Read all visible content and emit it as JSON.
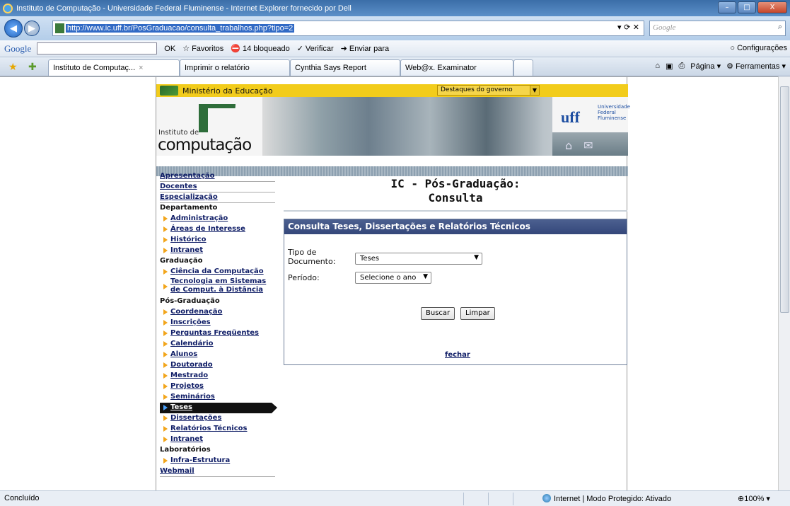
{
  "window": {
    "title": "Instituto de Computação - Universidade Federal Fluminense - Internet Explorer fornecido por Dell",
    "buttons": [
      "–",
      "□",
      "X"
    ]
  },
  "address": {
    "url": "http://www.ic.uff.br/PosGraduacao/consulta_trabalhos.php?tipo=2",
    "search_placeholder": "Google"
  },
  "google_bar": {
    "logo": "Google",
    "ok": "OK",
    "favoritos": "Favoritos",
    "bloqueado": "14 bloqueado",
    "verificar": "Verificar",
    "enviar": "Enviar para",
    "configuracoes": "Configurações"
  },
  "tabs": [
    {
      "label": "Instituto de Computaç...",
      "active": true
    },
    {
      "label": "Imprimir o relatório"
    },
    {
      "label": "Cynthia Says Report"
    },
    {
      "label": "Web@x. Examinator"
    }
  ],
  "tab_tools": {
    "pagina": "Página",
    "ferramentas": "Ferramentas"
  },
  "gov_bar": {
    "ministerio": "Ministério da Educação",
    "destaques": "Destaques do governo"
  },
  "banner": {
    "instituto": "Instituto de",
    "computacao": "computação",
    "uff_mark": "uff",
    "uff_name": [
      "Universidade",
      "Federal",
      "Fluminense"
    ]
  },
  "sidebar": {
    "items": [
      {
        "type": "top",
        "label": "Apresentação"
      },
      {
        "type": "top",
        "label": "Docentes"
      },
      {
        "type": "top",
        "label": "Especialização"
      },
      {
        "type": "cat",
        "label": "Departamento"
      },
      {
        "type": "sub",
        "label": "Administração"
      },
      {
        "type": "sub",
        "label": "Áreas de Interesse"
      },
      {
        "type": "sub",
        "label": "Histórico"
      },
      {
        "type": "sub",
        "label": "Intranet"
      },
      {
        "type": "cat",
        "label": "Graduação"
      },
      {
        "type": "sub",
        "label": "Ciência da Computação"
      },
      {
        "type": "sub2",
        "label": "Tecnologia em Sistemas",
        "label2": "de Comput. à Distância"
      },
      {
        "type": "cat",
        "label": "Pós-Graduação"
      },
      {
        "type": "sub",
        "label": "Coordenação"
      },
      {
        "type": "sub",
        "label": "Inscrições"
      },
      {
        "type": "sub",
        "label": "Perguntas Freqüentes"
      },
      {
        "type": "sub",
        "label": "Calendário"
      },
      {
        "type": "sub",
        "label": "Alunos"
      },
      {
        "type": "sub",
        "label": "Doutorado"
      },
      {
        "type": "sub",
        "label": "Mestrado"
      },
      {
        "type": "sub",
        "label": "Projetos"
      },
      {
        "type": "sub",
        "label": "Seminários"
      },
      {
        "type": "sub",
        "label": "Teses",
        "active": true
      },
      {
        "type": "sub",
        "label": "Dissertações"
      },
      {
        "type": "sub",
        "label": "Relatórios Técnicos"
      },
      {
        "type": "sub",
        "label": "Intranet"
      },
      {
        "type": "cat",
        "label": "Laboratórios"
      },
      {
        "type": "sub",
        "label": "Infra-Estrutura"
      },
      {
        "type": "top",
        "label": "Webmail"
      }
    ]
  },
  "main": {
    "title_line1": "IC - Pós-Graduação:",
    "title_line2": "Consulta",
    "box_title": "Consulta Teses, Dissertações e Relatórios Técnicos",
    "tipo_label_1": "Tipo de",
    "tipo_label_2": "Documento:",
    "tipo_value": "Teses",
    "periodo_label": "Período:",
    "periodo_value": "Selecione o ano",
    "buscar": "Buscar",
    "limpar": "Limpar",
    "fechar": "fechar"
  },
  "status": {
    "left": "Concluído",
    "zone": "Internet | Modo Protegido: Ativado",
    "zoom": "100%"
  }
}
